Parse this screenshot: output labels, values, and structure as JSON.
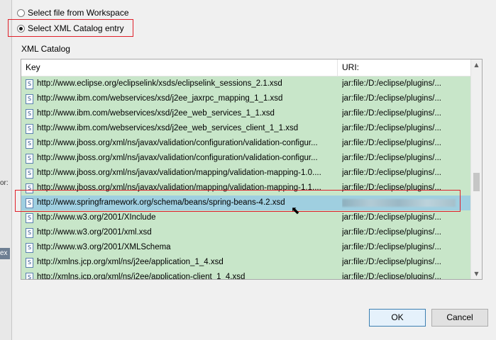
{
  "radios": {
    "workspace_label": "Select file from Workspace",
    "catalog_label": "Select XML Catalog entry"
  },
  "catalog": {
    "label": "XML Catalog",
    "columns": {
      "key": "Key",
      "uri": "URI:"
    },
    "rows": [
      {
        "key": "http://www.eclipse.org/eclipselink/xsds/eclipselink_sessions_2.1.xsd",
        "uri": "jar:file:/D:/eclipse/plugins/..."
      },
      {
        "key": "http://www.ibm.com/webservices/xsd/j2ee_jaxrpc_mapping_1_1.xsd",
        "uri": "jar:file:/D:/eclipse/plugins/..."
      },
      {
        "key": "http://www.ibm.com/webservices/xsd/j2ee_web_services_1_1.xsd",
        "uri": "jar:file:/D:/eclipse/plugins/..."
      },
      {
        "key": "http://www.ibm.com/webservices/xsd/j2ee_web_services_client_1_1.xsd",
        "uri": "jar:file:/D:/eclipse/plugins/..."
      },
      {
        "key": "http://www.jboss.org/xml/ns/javax/validation/configuration/validation-configur...",
        "uri": "jar:file:/D:/eclipse/plugins/..."
      },
      {
        "key": "http://www.jboss.org/xml/ns/javax/validation/configuration/validation-configur...",
        "uri": "jar:file:/D:/eclipse/plugins/..."
      },
      {
        "key": "http://www.jboss.org/xml/ns/javax/validation/mapping/validation-mapping-1.0....",
        "uri": "jar:file:/D:/eclipse/plugins/..."
      },
      {
        "key": "http://www.jboss.org/xml/ns/javax/validation/mapping/validation-mapping-1.1....",
        "uri": "jar:file:/D:/eclipse/plugins/..."
      },
      {
        "key": "http://www.springframework.org/schema/beans/spring-beans-4.2.xsd",
        "uri": "",
        "selected": true
      },
      {
        "key": "http://www.w3.org/2001/XInclude",
        "uri": "jar:file:/D:/eclipse/plugins/..."
      },
      {
        "key": "http://www.w3.org/2001/xml.xsd",
        "uri": "jar:file:/D:/eclipse/plugins/..."
      },
      {
        "key": "http://www.w3.org/2001/XMLSchema",
        "uri": "jar:file:/D:/eclipse/plugins/..."
      },
      {
        "key": "http://xmlns.jcp.org/xml/ns/j2ee/application_1_4.xsd",
        "uri": "jar:file:/D:/eclipse/plugins/..."
      },
      {
        "key": "http://xmlns.jcp.org/xml/ns/j2ee/application-client_1_4.xsd",
        "uri": "jar:file:/D:/eclipse/plugins/..."
      }
    ]
  },
  "buttons": {
    "ok": "OK",
    "cancel": "Cancel"
  },
  "left_strip": {
    "frag1": "or:",
    "frag2": "ex"
  },
  "colors": {
    "row_bg": "#c8e6c9",
    "selected_bg": "#9fcfe0",
    "highlight": "#e0202a"
  }
}
